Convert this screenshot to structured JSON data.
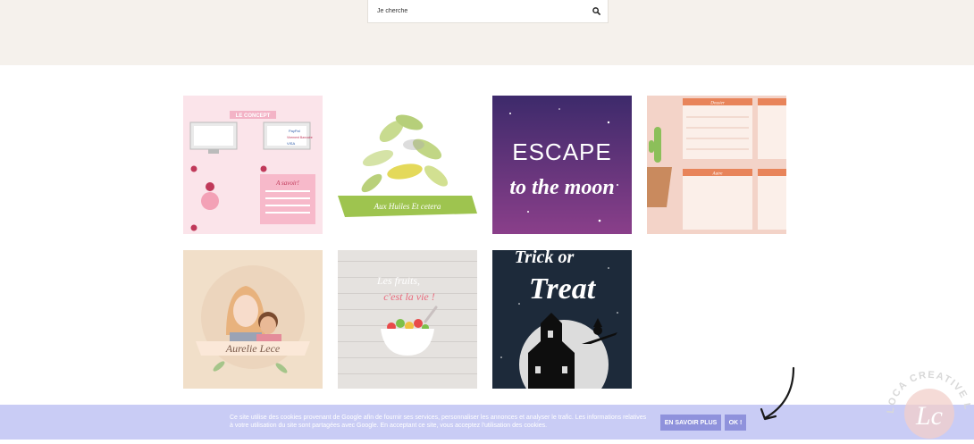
{
  "search": {
    "placeholder": "Je cherche",
    "icon": "search-icon"
  },
  "gallery": {
    "tiles": [
      {
        "name": "le-concept",
        "title": "LE CONCEPT",
        "note": "A savoir!",
        "paypal": "PayPal",
        "bank": "Virement Bancaire",
        "visa": "VISA"
      },
      {
        "name": "aux-huiles",
        "title": "Aux Huiles Et cetera"
      },
      {
        "name": "escape-moon",
        "line1": "ESCAPE",
        "line2": "to the moon"
      },
      {
        "name": "dossier-planner",
        "label1": "Dossier",
        "label2": "Autre"
      },
      {
        "name": "aurelie-lece",
        "title": "Aurelie Lece"
      },
      {
        "name": "les-fruits",
        "line1": "Les fruits,",
        "line2": "c'est la vie !"
      },
      {
        "name": "trick-or-treat",
        "line1": "Trick or",
        "line2": "Treat"
      }
    ]
  },
  "cookie": {
    "text": "Ce site utilise des cookies provenant de Google afin de fournir ses services, personnaliser les annonces et analyser le trafic. Les informations relatives à votre utilisation du site sont partagées avec Google. En acceptant ce site, vous acceptez l'utilisation des cookies.",
    "more_label": "EN SAVOIR PLUS",
    "ok_label": "OK !"
  },
  "logo": {
    "text": "LOCA CREATIVE LE BLOG",
    "initials": "Lc"
  },
  "colors": {
    "header_bg": "#f5f1ec",
    "cookie_bg": "#c9ccf5",
    "button_bg": "#8f92dc"
  }
}
